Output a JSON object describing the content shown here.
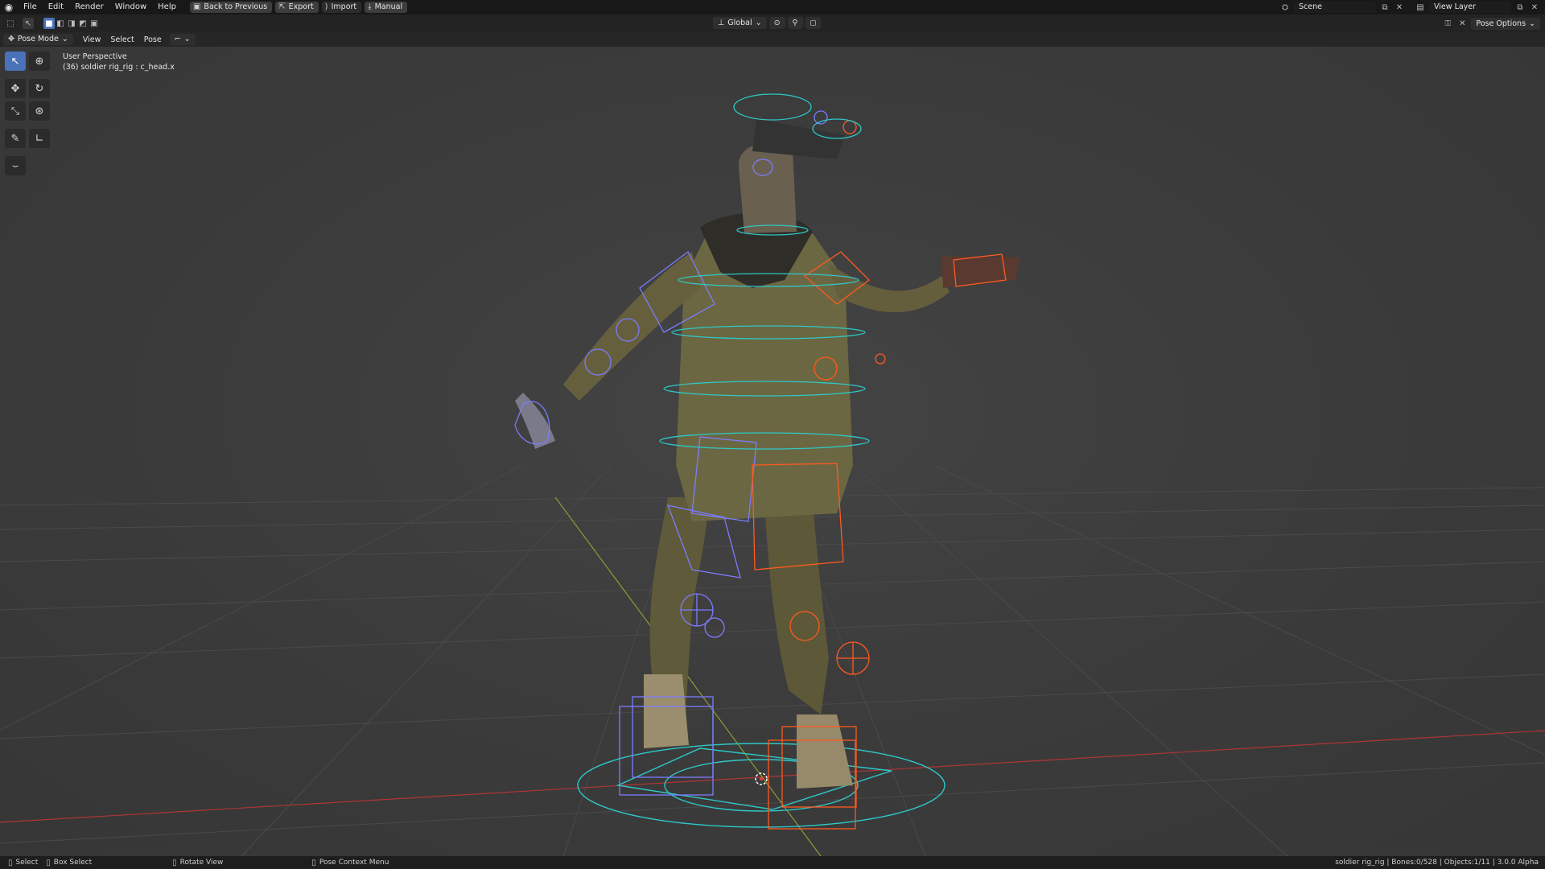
{
  "topbar": {
    "menus": [
      "File",
      "Edit",
      "Render",
      "Window",
      "Help"
    ],
    "back_to_previous": "Back to Previous",
    "export": "Export",
    "import": "Import",
    "manual": "Manual",
    "scene": "Scene",
    "view_layer": "View Layer"
  },
  "tool_header": {
    "transform_orientation": "Global",
    "pose_options": "Pose Options"
  },
  "mode_header": {
    "mode": "Pose Mode",
    "menus": [
      "View",
      "Select",
      "Pose"
    ]
  },
  "viewport": {
    "perspective": "User Perspective",
    "active": "(36) soldier rig_rig : c_head.x"
  },
  "statusbar": {
    "select": "Select",
    "box_select": "Box Select",
    "rotate_view": "Rotate View",
    "context_menu": "Pose Context Menu",
    "info": "soldier rig_rig | Bones:0/528 | Objects:1/11 | 3.0.0 Alpha"
  },
  "colors": {
    "accent": "#4a72b8",
    "bone_left": "#7b7bff",
    "bone_right": "#ff5a1f",
    "root_control": "#30d0d0",
    "x_axis": "#c03030",
    "y_axis": "#8aa030"
  },
  "icons": [
    "blender-logo-icon",
    "cursor-select-icon",
    "cursor-icon",
    "move-icon",
    "rotate-icon",
    "scale-icon",
    "transform-icon",
    "annotate-icon",
    "measure-icon",
    "relax-icon",
    "mouse-icon"
  ]
}
